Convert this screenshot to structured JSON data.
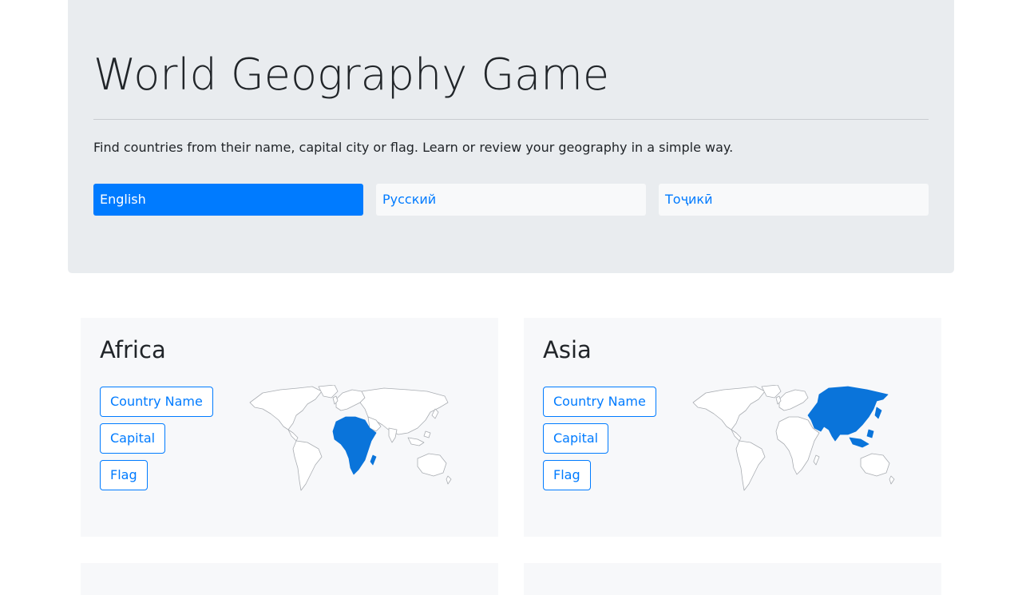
{
  "header": {
    "title": "World Geography Game",
    "lead": "Find countries from their name, capital city or flag. Learn or review your geography in a simple way."
  },
  "languages": [
    {
      "label": "English",
      "active": true
    },
    {
      "label": "Русский",
      "active": false
    },
    {
      "label": "Тоҷикӣ",
      "active": false
    }
  ],
  "continents": [
    {
      "name": "Africa",
      "highlight": "africa",
      "buttons": {
        "name": "Country Name",
        "capital": "Capital",
        "flag": "Flag"
      }
    },
    {
      "name": "Asia",
      "highlight": "asia",
      "buttons": {
        "name": "Country Name",
        "capital": "Capital",
        "flag": "Flag"
      }
    }
  ],
  "colors": {
    "primary": "#007bff",
    "jumbotron": "#e9ecef",
    "card": "#f7f8fa",
    "map_highlight": "#0a74da"
  }
}
